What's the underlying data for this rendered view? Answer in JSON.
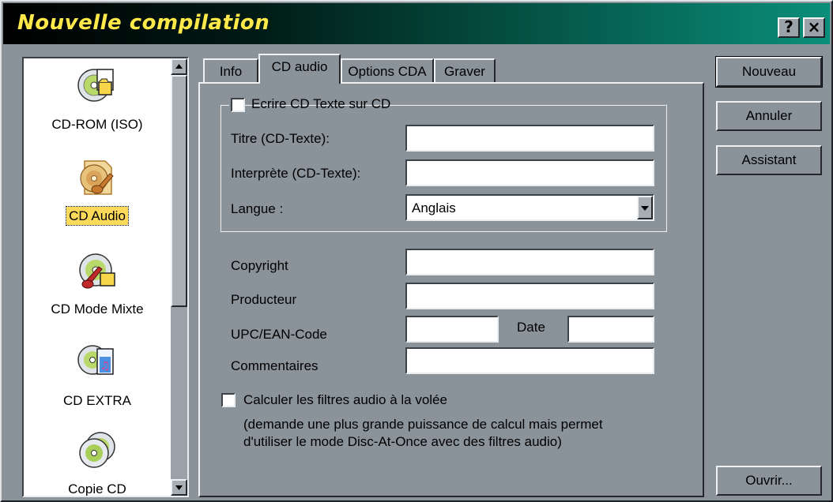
{
  "window": {
    "title": "Nouvelle compilation",
    "help_label": "?",
    "close_label": "×"
  },
  "list_items": [
    {
      "label": "CD-ROM (ISO)",
      "icon": "cd-rom-iso-icon"
    },
    {
      "label": "CD Audio",
      "icon": "cd-audio-icon",
      "selected": true
    },
    {
      "label": "CD Mode Mixte",
      "icon": "cd-mixed-mode-icon"
    },
    {
      "label": "CD EXTRA",
      "icon": "cd-extra-icon"
    },
    {
      "label": "Copie CD",
      "icon": "copy-cd-icon"
    }
  ],
  "tabs": [
    {
      "label": "Info"
    },
    {
      "label": "CD audio",
      "active": true
    },
    {
      "label": "Options CDA"
    },
    {
      "label": "Graver"
    }
  ],
  "cd_text": {
    "checkbox_label": "Ecrire CD Texte sur CD",
    "title_label": "Titre (CD-Texte):",
    "title_value": "",
    "performer_label": "Interprète (CD-Texte):",
    "performer_value": "",
    "language_label": "Langue :",
    "language_value": "Anglais"
  },
  "fields": {
    "copyright_label": "Copyright",
    "copyright_value": "",
    "producer_label": "Producteur",
    "producer_value": "",
    "upc_label": "UPC/EAN-Code",
    "upc_value": "",
    "date_label": "Date",
    "date_value": "",
    "comments_label": "Commentaires",
    "comments_value": ""
  },
  "filters": {
    "checkbox_label": "Calculer les filtres audio à la volée",
    "note_line1": "(demande une plus grande puissance de calcul mais permet",
    "note_line2": "d'utiliser le mode Disc-At-Once avec des filtres audio)"
  },
  "buttons": {
    "new": "Nouveau",
    "cancel": "Annuler",
    "wizard": "Assistant",
    "open": "Ouvrir..."
  }
}
